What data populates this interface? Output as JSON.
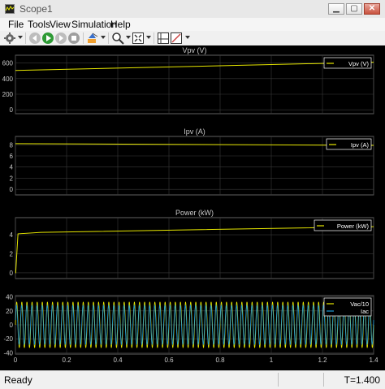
{
  "window": {
    "title": "Scope1",
    "minimize": "▁",
    "maximize": "▢",
    "close": "✕"
  },
  "menu": [
    "File",
    "Tools",
    "View",
    "Simulation",
    "Help"
  ],
  "toolbar": [
    "settings-icon",
    "run-icon",
    "step-forward-icon",
    "stop-icon",
    "highlight-icon",
    "zoom-icon",
    "fit-to-view-icon",
    "cursor-measure-icon",
    "triggers-icon"
  ],
  "colors": {
    "axes_bg": "#000000",
    "grid": "#3a3a3a",
    "axis_text": "#c8c8c8",
    "series1": "#e6e600",
    "series2": "#1f9bd7",
    "legend_bg": "#000000",
    "legend_border": "#ffffff"
  },
  "status": {
    "text": "Ready",
    "time": "T=1.400"
  },
  "chart_data": [
    {
      "type": "line",
      "title": "Vpv (V)",
      "ylim": [
        -50,
        700
      ],
      "yticks": [
        0,
        200,
        400,
        600
      ],
      "series": [
        {
          "name": "Vpv (V)",
          "x": [
            0,
            1.4
          ],
          "y": [
            505,
            610
          ]
        }
      ]
    },
    {
      "type": "line",
      "title": "Ipv (A)",
      "ylim": [
        -1,
        9.5
      ],
      "yticks": [
        0,
        2,
        4,
        6,
        8
      ],
      "series": [
        {
          "name": "Ipv (A)",
          "x": [
            0,
            1.4
          ],
          "y": [
            8.2,
            7.9
          ]
        }
      ]
    },
    {
      "type": "line",
      "title": "Power (kW)",
      "ylim": [
        -0.6,
        5.8
      ],
      "yticks": [
        0,
        2,
        4
      ],
      "series": [
        {
          "name": "Power (kW)",
          "x": [
            0,
            0.001,
            0.01,
            0.1,
            1.4
          ],
          "y": [
            0,
            0,
            4.1,
            4.25,
            4.85
          ]
        }
      ]
    },
    {
      "type": "line",
      "title": "",
      "ylim": [
        -42,
        42
      ],
      "yticks": [
        -40,
        -20,
        0,
        20,
        40
      ],
      "xticks": [
        0,
        0.2,
        0.4,
        0.6,
        0.8,
        1,
        1.2,
        1.4
      ],
      "xlim": [
        0,
        1.4
      ],
      "series": [
        {
          "name": "Vac/10",
          "amplitude": 33,
          "frequency_hz": 50
        },
        {
          "name": "Iac",
          "amplitude": 28,
          "frequency_hz": 50
        }
      ]
    }
  ]
}
